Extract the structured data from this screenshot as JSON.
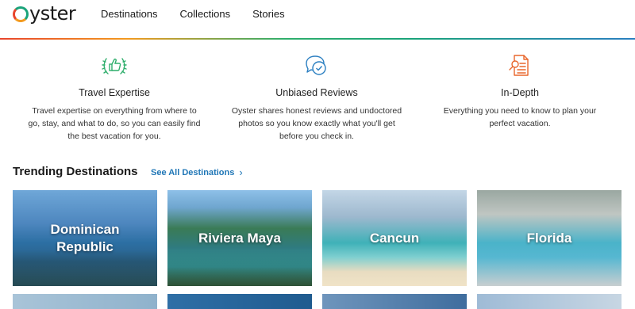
{
  "header": {
    "logo_text": "yster",
    "nav": [
      {
        "label": "Destinations"
      },
      {
        "label": "Collections"
      },
      {
        "label": "Stories"
      }
    ]
  },
  "features": [
    {
      "icon": "thumbs-up-laurel-icon",
      "title": "Travel Expertise",
      "text": "Travel expertise on everything from where to go, stay, and what to do, so you can easily find the best vacation for you."
    },
    {
      "icon": "chat-check-icon",
      "title": "Unbiased Reviews",
      "text": "Oyster shares honest reviews and undoctored photos so you know exactly what you'll get before you check in."
    },
    {
      "icon": "document-search-icon",
      "title": "In-Depth",
      "text": "Everything you need to know to plan your perfect vacation."
    }
  ],
  "trending": {
    "title": "Trending Destinations",
    "see_all": "See All Destinations",
    "cards": [
      {
        "label": "Dominican Republic"
      },
      {
        "label": "Riviera Maya"
      },
      {
        "label": "Cancun"
      },
      {
        "label": "Florida"
      }
    ]
  },
  "colors": {
    "accent_link": "#1f76b6",
    "icon_green": "#2fae6c",
    "icon_blue": "#2b7fc1",
    "icon_orange": "#e8662c"
  }
}
